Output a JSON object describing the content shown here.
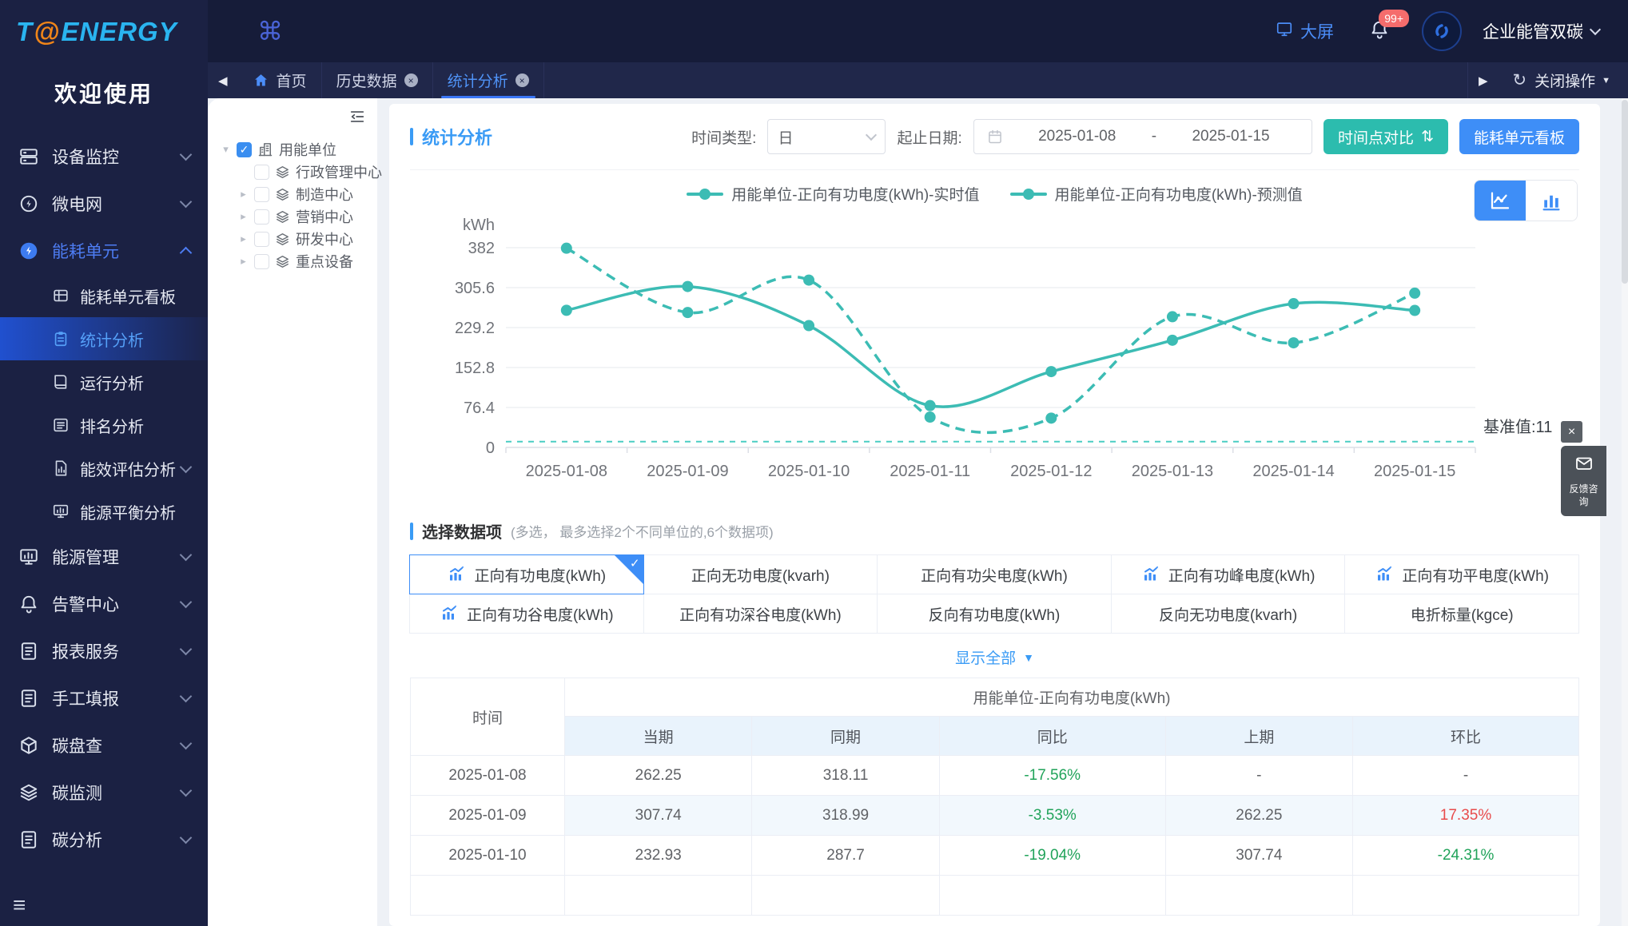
{
  "colors": {
    "accent": "#3e8ef7",
    "teal_button": "#2cbcae",
    "chart_line": "#3cbcb4",
    "green": "#21a35a",
    "red": "#e84b4b",
    "badge": "#f56c6c"
  },
  "icons": {
    "check": "✓",
    "caret_down": "▾",
    "caret_right": "▸",
    "sort": "⇅",
    "cmd": "⌘",
    "tri_down": "▼",
    "left_arrow": "◀",
    "right_arrow": "▶",
    "refresh": "↻",
    "hamburger": "≡",
    "close": "×"
  },
  "app": {
    "logo_t": "T",
    "logo_at": "@",
    "logo_energy": "ENERGY",
    "welcome": "欢迎使用",
    "big_screen": "大屏",
    "badge": "99+",
    "org": "企业能管双碳",
    "close_action": "关闭操作"
  },
  "sidebar": {
    "items": [
      {
        "label": "设备监控",
        "icon": "server",
        "chevron": "down"
      },
      {
        "label": "微电网",
        "icon": "bolt",
        "chevron": "down"
      },
      {
        "label": "能耗单元",
        "icon": "bolt-filled",
        "chevron": "up",
        "open": true
      },
      {
        "label": "能耗单元看板",
        "icon": "board",
        "sub": true
      },
      {
        "label": "统计分析",
        "icon": "clipboard",
        "sub": true,
        "active": true
      },
      {
        "label": "运行分析",
        "icon": "book",
        "sub": true
      },
      {
        "label": "排名分析",
        "icon": "list",
        "sub": true
      },
      {
        "label": "能效评估分析",
        "icon": "file-chart",
        "sub": true,
        "chevron": "down"
      },
      {
        "label": "能源平衡分析",
        "icon": "monitor-chart",
        "sub": true
      },
      {
        "label": "能源管理",
        "icon": "monitor-chart",
        "chevron": "down"
      },
      {
        "label": "告警中心",
        "icon": "bell",
        "chevron": "down"
      },
      {
        "label": "报表服务",
        "icon": "doc",
        "chevron": "down"
      },
      {
        "label": "手工填报",
        "icon": "doc",
        "chevron": "down"
      },
      {
        "label": "碳盘查",
        "icon": "cube",
        "chevron": "down"
      },
      {
        "label": "碳监测",
        "icon": "layers",
        "chevron": "down"
      },
      {
        "label": "碳分析",
        "icon": "doc",
        "chevron": "down"
      }
    ]
  },
  "tabs": [
    {
      "label": "首页",
      "home": true,
      "closable": false,
      "active": false
    },
    {
      "label": "历史数据",
      "home": false,
      "closable": true,
      "active": false
    },
    {
      "label": "统计分析",
      "home": false,
      "closable": true,
      "active": true
    }
  ],
  "tree": {
    "root": {
      "label": "用能单位",
      "checked": true
    },
    "children": [
      {
        "label": "行政管理中心",
        "expandable": false
      },
      {
        "label": "制造中心",
        "expandable": true
      },
      {
        "label": "营销中心",
        "expandable": true
      },
      {
        "label": "研发中心",
        "expandable": true
      },
      {
        "label": "重点设备",
        "expandable": true
      }
    ]
  },
  "toolbar": {
    "title": "统计分析",
    "time_type_label": "时间类型:",
    "time_type_value": "日",
    "date_label": "起止日期:",
    "date_start": "2025-01-08",
    "date_sep": "-",
    "date_end": "2025-01-15",
    "compare_btn": "时间点对比",
    "board_btn": "能耗单元看板"
  },
  "chart_data": {
    "type": "line",
    "title": "",
    "ylabel": "kWh",
    "ymax": 382,
    "yticks": [
      0,
      76.4,
      152.8,
      229.2,
      305.6,
      382
    ],
    "categories": [
      "2025-01-08",
      "2025-01-09",
      "2025-01-10",
      "2025-01-11",
      "2025-01-12",
      "2025-01-13",
      "2025-01-14",
      "2025-01-15"
    ],
    "series": [
      {
        "name": "用能单位-正向有功电度(kWh)-实时值",
        "dashed": false,
        "values": [
          262.25,
          307.74,
          232.93,
          80,
          145,
          205,
          275,
          262
        ]
      },
      {
        "name": "用能单位-正向有功电度(kWh)-预测值",
        "dashed": true,
        "values": [
          381,
          258,
          320,
          58,
          56,
          250,
          200,
          295
        ]
      }
    ],
    "baseline": {
      "value": 11,
      "label": "基准值:11"
    },
    "legend_position": "top",
    "grid": true
  },
  "selector": {
    "title": "选择数据项",
    "hint": "(多选， 最多选择2个不同单位的,6个数据项)",
    "items": [
      {
        "label": "正向有功电度(kWh)",
        "icon": true,
        "selected": true
      },
      {
        "label": "正向无功电度(kvarh)",
        "icon": false,
        "selected": false
      },
      {
        "label": "正向有功尖电度(kWh)",
        "icon": false,
        "selected": false
      },
      {
        "label": "正向有功峰电度(kWh)",
        "icon": true,
        "selected": false
      },
      {
        "label": "正向有功平电度(kWh)",
        "icon": true,
        "selected": false
      },
      {
        "label": "正向有功谷电度(kWh)",
        "icon": true,
        "selected": false
      },
      {
        "label": "正向有功深谷电度(kWh)",
        "icon": false,
        "selected": false
      },
      {
        "label": "反向有功电度(kWh)",
        "icon": false,
        "selected": false
      },
      {
        "label": "反向无功电度(kvarh)",
        "icon": false,
        "selected": false
      },
      {
        "label": "电折标量(kgce)",
        "icon": false,
        "selected": false
      }
    ],
    "show_all": "显示全部"
  },
  "table": {
    "time_header": "时间",
    "group_header": "用能单位-正向有功电度(kWh)",
    "sub_headers": [
      "当期",
      "同期",
      "同比",
      "上期",
      "环比"
    ],
    "rows": [
      {
        "time": "2025-01-08",
        "cells": [
          {
            "text": "262.25",
            "tone": ""
          },
          {
            "text": "318.11",
            "tone": ""
          },
          {
            "text": "-17.56%",
            "tone": "green"
          },
          {
            "text": "-",
            "tone": ""
          },
          {
            "text": "-",
            "tone": ""
          }
        ]
      },
      {
        "time": "2025-01-09",
        "cells": [
          {
            "text": "307.74",
            "tone": ""
          },
          {
            "text": "318.99",
            "tone": ""
          },
          {
            "text": "-3.53%",
            "tone": "green"
          },
          {
            "text": "262.25",
            "tone": ""
          },
          {
            "text": "17.35%",
            "tone": "red"
          }
        ]
      },
      {
        "time": "2025-01-10",
        "cells": [
          {
            "text": "232.93",
            "tone": ""
          },
          {
            "text": "287.7",
            "tone": ""
          },
          {
            "text": "-19.04%",
            "tone": "green"
          },
          {
            "text": "307.74",
            "tone": ""
          },
          {
            "text": "-24.31%",
            "tone": "green"
          }
        ]
      },
      {
        "time": "",
        "cells": [
          {
            "text": "",
            "tone": ""
          },
          {
            "text": "",
            "tone": ""
          },
          {
            "text": "",
            "tone": ""
          },
          {
            "text": "",
            "tone": ""
          },
          {
            "text": "",
            "tone": ""
          }
        ]
      }
    ]
  },
  "feedback": {
    "label": "反馈咨询"
  }
}
